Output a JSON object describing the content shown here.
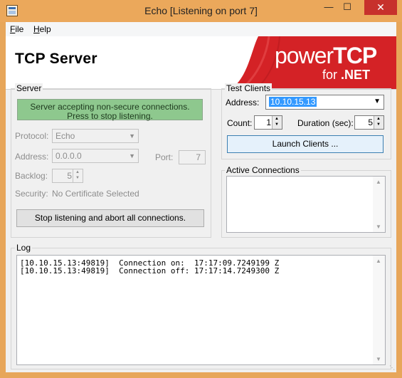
{
  "window": {
    "title": "Echo [Listening on port 7]",
    "minimize": "—",
    "maximize": "☐",
    "close": "✕"
  },
  "menu": {
    "file": {
      "accel": "F",
      "rest": "ile"
    },
    "help": {
      "accel": "H",
      "rest": "elp"
    }
  },
  "banner": {
    "title": "TCP Server",
    "logo_power": "power",
    "logo_tcp": "TCP",
    "logo_for": "for ",
    "logo_net": ".NET",
    "brand_color": "#d42226"
  },
  "server": {
    "group_label": "Server",
    "status_button_line1": "Server accepting non-secure connections.",
    "status_button_line2": "Press to stop listening.",
    "protocol_label": "Protocol:",
    "protocol_value": "Echo",
    "address_label": "Address:",
    "address_value": "0.0.0.0",
    "port_label": "Port:",
    "port_value": "7",
    "backlog_label": "Backlog:",
    "backlog_value": "5",
    "security_label": "Security:",
    "security_value": "No Certificate Selected",
    "stop_button": "Stop listening and abort all connections."
  },
  "test_clients": {
    "group_label": "Test Clients",
    "address_label": "Address:",
    "address_value": "10.10.15.13",
    "count_label": "Count:",
    "count_value": "1",
    "duration_label": "Duration (sec):",
    "duration_value": "5",
    "launch_button": "Launch Clients ..."
  },
  "active_connections": {
    "group_label": "Active Connections"
  },
  "log": {
    "group_label": "Log",
    "lines": [
      "[10.10.15.13:49819]  Connection on:  17:17:09.7249199 Z",
      "[10.10.15.13:49819]  Connection off: 17:17:14.7249300 Z"
    ]
  },
  "colors": {
    "title_bar": "#eba85b",
    "close_button": "#c7312c",
    "status_green": "#8ec88e",
    "selection": "#3399ff"
  }
}
